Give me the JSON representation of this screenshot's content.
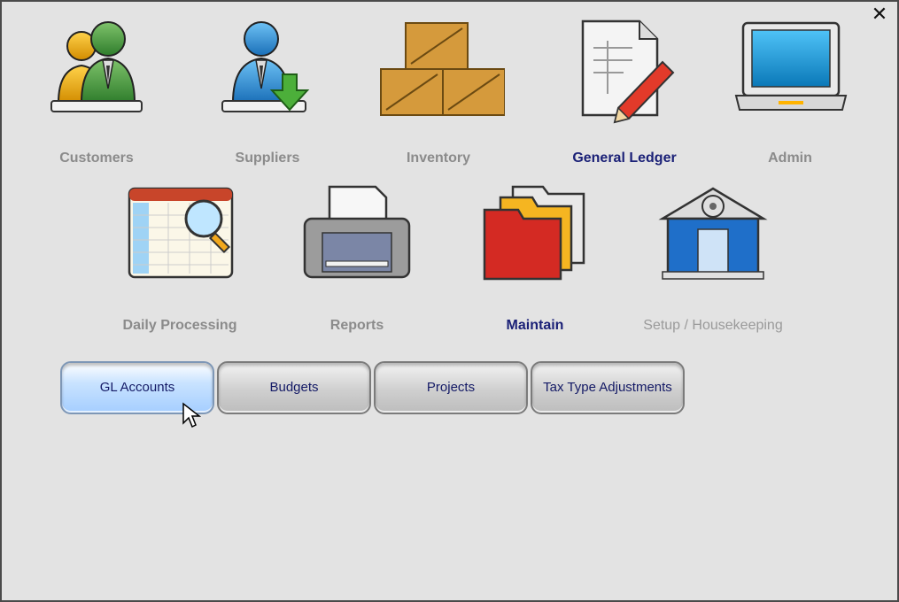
{
  "window": {
    "close_symbol": "✕"
  },
  "modules_row1": [
    {
      "label": "Customers",
      "icon": "customers-icon"
    },
    {
      "label": "Suppliers",
      "icon": "suppliers-icon"
    },
    {
      "label": "Inventory",
      "icon": "inventory-icon"
    },
    {
      "label": "General Ledger",
      "icon": "general-ledger-icon"
    },
    {
      "label": "Admin",
      "icon": "admin-laptop-icon"
    }
  ],
  "modules_row2": [
    {
      "label": "Daily Processing",
      "icon": "daily-processing-icon"
    },
    {
      "label": "Reports",
      "icon": "printer-icon"
    },
    {
      "label": "Maintain",
      "icon": "folders-icon"
    },
    {
      "label": "Setup / Housekeeping",
      "icon": "building-gear-icon"
    }
  ],
  "sub_buttons": [
    {
      "label": "GL Accounts"
    },
    {
      "label": "Budgets"
    },
    {
      "label": "Projects"
    },
    {
      "label": "Tax Type Adjustments"
    }
  ],
  "colors": {
    "active_label": "#1b2177",
    "inactive_label": "#8b8b8b",
    "selected_button": "#a5ceff"
  }
}
